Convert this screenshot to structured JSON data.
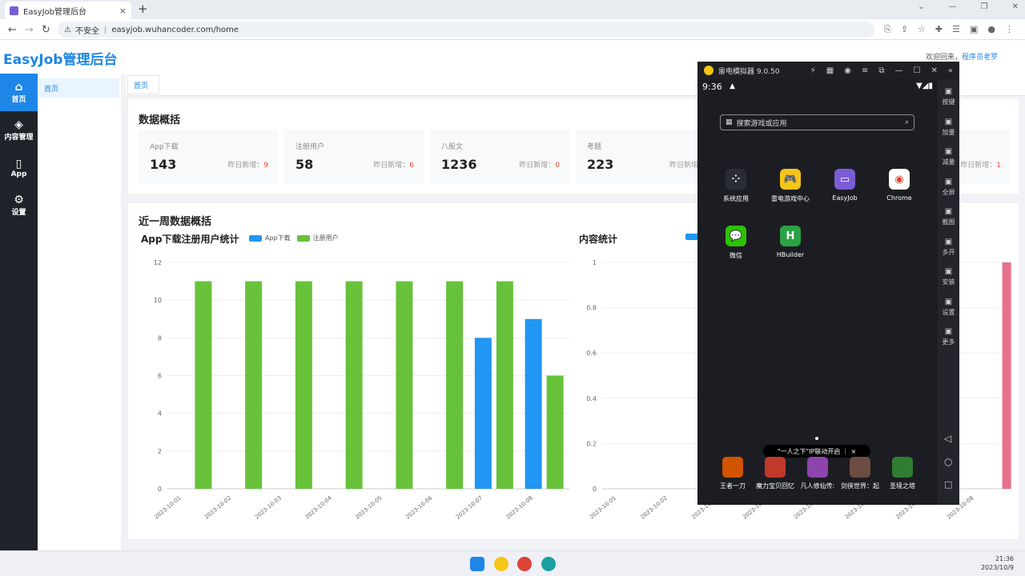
{
  "browser": {
    "tab_title": "EasyJob管理后台",
    "close": "×",
    "new_tab": "+",
    "url_warning": "不安全",
    "url": "easyjob.wuhancoder.com/home",
    "back": "←",
    "forward": "→",
    "reload": "↻"
  },
  "header": {
    "logo": "EasyJob管理后台",
    "welcome": "欢迎回来，",
    "user": "程序员老罗"
  },
  "sidebar": {
    "items": [
      {
        "label": "首页",
        "icon": "home-icon"
      },
      {
        "label": "内容管理",
        "icon": "layers-icon"
      },
      {
        "label": "App",
        "icon": "phone-icon"
      },
      {
        "label": "设置",
        "icon": "gear-icon"
      }
    ]
  },
  "submenu": {
    "item": "首页"
  },
  "tags": {
    "home": "首页"
  },
  "overview": {
    "title": "数据概括",
    "new_label": "昨日新增：",
    "stats": [
      {
        "label": "App下载",
        "value": "143",
        "new": "9"
      },
      {
        "label": "注册用户",
        "value": "58",
        "new": "6"
      },
      {
        "label": "八股文",
        "value": "1236",
        "new": "0"
      },
      {
        "label": "考题",
        "value": "223",
        "new": ""
      }
    ],
    "hidden_new": "1"
  },
  "week": {
    "title": "近一周数据概括",
    "chart1_title": "App下载注册用户统计",
    "chart2_title": "内容统计"
  },
  "chart_data": [
    {
      "type": "bar",
      "title": "App下载注册用户统计",
      "categories": [
        "2023-10-01",
        "2023-10-02",
        "2023-10-03",
        "2023-10-04",
        "2023-10-05",
        "2023-10-06",
        "2023-10-07",
        "2023-10-08"
      ],
      "series": [
        {
          "name": "App下载",
          "color": "#2196f3",
          "values": [
            0,
            0,
            0,
            0,
            0,
            0,
            8,
            9
          ]
        },
        {
          "name": "注册用户",
          "color": "#67c23a",
          "values": [
            11,
            11,
            11,
            11,
            11,
            11,
            11,
            6
          ]
        }
      ],
      "ylim": [
        0,
        12
      ],
      "yticks": [
        "12",
        "10",
        "8",
        "6",
        "4",
        "2",
        "0"
      ],
      "legend": "top"
    },
    {
      "type": "bar",
      "title": "内容统计",
      "categories": [
        "2023-10-01",
        "2023-10-02",
        "2023-10-03",
        "2023-10-04",
        "2023-10-05",
        "2023-10-06",
        "2023-10-07",
        "2023-10-08"
      ],
      "series": [
        {
          "color": "#e8718d",
          "values": [
            0,
            0,
            0,
            0,
            0,
            0,
            0,
            1
          ]
        }
      ],
      "ylim": [
        0,
        1
      ],
      "yticks": [
        "1",
        "0.8",
        "0.6",
        "0.4",
        "0.2",
        "0"
      ]
    }
  ],
  "emulator": {
    "title": "雷电模拟器 9.0.50",
    "time": "9:36",
    "search_placeholder": "搜索游戏或应用",
    "apps": [
      {
        "label": "系统应用",
        "color": "#2a2c33",
        "glyph": "⁘"
      },
      {
        "label": "雷电游戏中心",
        "color": "#f5c518",
        "glyph": "🎮"
      },
      {
        "label": "EasyJob",
        "color": "#7b5cd6",
        "glyph": "▭"
      },
      {
        "label": "Chrome",
        "color": "#ffffff",
        "glyph": "◉"
      },
      {
        "label": "微信",
        "color": "#2dc100",
        "glyph": "💬"
      },
      {
        "label": "HBuilder",
        "color": "#2ba245",
        "glyph": "H"
      }
    ],
    "banner": "\"一人之下\"IP联动开启 ｜ ×",
    "games": [
      "王者一刀",
      "魔力宝贝回忆",
      "凡人修仙传:",
      "剑侠世界：起",
      "圣境之塔"
    ],
    "side": [
      "按键",
      "加量",
      "减量",
      "全屏",
      "截图",
      "多开",
      "安装",
      "设置",
      "更多"
    ]
  },
  "taskbar": {
    "time": "21:36",
    "date": "2023/10/9"
  }
}
